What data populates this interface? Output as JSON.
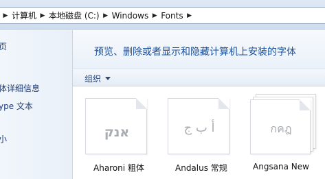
{
  "address_bar": {
    "crumbs": [
      "计算机",
      "本地磁盘 (C:)",
      "Windows",
      "Fonts"
    ]
  },
  "nav": {
    "items": [
      "页",
      "体详细信息",
      "ype 文本",
      "小"
    ]
  },
  "content": {
    "description": "预览、删除或者显示和隐藏计算机上安装的字体",
    "toolbar": {
      "organize_label": "组织"
    },
    "fonts": [
      {
        "sample": "אנק",
        "name": "Aharoni 粗体"
      },
      {
        "sample": "أ ب ج",
        "name": "Andalus 常规"
      },
      {
        "sample": "กคฎ",
        "name": "Angsana New"
      }
    ]
  }
}
